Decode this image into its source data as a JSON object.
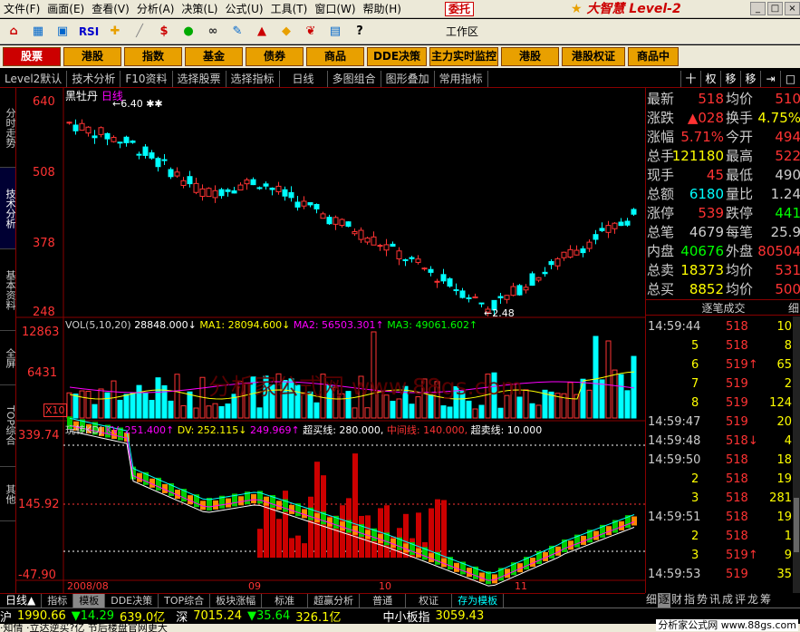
{
  "menu": [
    "文件(F)",
    "画面(E)",
    "查看(V)",
    "分析(A)",
    "决策(L)",
    "公式(U)",
    "工具(T)",
    "窗口(W)",
    "帮助(H)"
  ],
  "entrust": "委托",
  "logo": "大智慧 Level-2",
  "toolbar_icons": [
    "home-icon",
    "grid-icon",
    "window-icon",
    "rsi-icon",
    "sparkle-icon",
    "ruler-icon",
    "dollar-icon",
    "lights-icon",
    "binoculars-icon",
    "broom-icon",
    "hat-icon",
    "diamond-icon",
    "leaf-icon",
    "chart-icon",
    "help-icon"
  ],
  "toolbar": {
    "rsi": "RSI",
    "workspace": "工作区"
  },
  "nav_buttons": [
    {
      "label": "股票",
      "selected": true
    },
    {
      "label": "港股"
    },
    {
      "label": "指数"
    },
    {
      "label": "基金"
    },
    {
      "label": "债券"
    },
    {
      "label": "商品"
    },
    {
      "label": "DDE决策"
    },
    {
      "label": "主力实时监控"
    },
    {
      "label": "港股"
    },
    {
      "label": "港股权证"
    },
    {
      "label": "商品中"
    }
  ],
  "tabs": [
    "Level2默认",
    "技术分析",
    "F10资料",
    "选择股票",
    "选择指标",
    "日线",
    "多图组合",
    "图形叠加",
    "常用指标"
  ],
  "tabs_right": [
    "十",
    "权",
    "移",
    "移"
  ],
  "left_tabs": [
    {
      "label": "分时走势"
    },
    {
      "label": "技术分析",
      "selected": true
    },
    {
      "label": "基本资料"
    },
    {
      "label": "全屏"
    },
    {
      "label": "TOP综合"
    },
    {
      "label": "其他"
    }
  ],
  "chart": {
    "stock_name": "黑牡丹",
    "period": "日线",
    "price_axis": [
      "640",
      "508",
      "378",
      "248"
    ],
    "max_mark": "6.40",
    "min_mark": "2.48",
    "vol_header": {
      "label": "VOL(5,10,20)",
      "vol": "28848.000↓",
      "ma1": "MA1: 28094.600↓",
      "ma2": "MA2: 56503.301↑",
      "ma3": "MA3: 49061.602↑"
    },
    "vol_axis": [
      "12863",
      "6431",
      "X10"
    ],
    "ind_header": {
      "label": "玩转KDJ",
      "kv": "KV: 251.400↑",
      "dv": "DV: 252.115↓",
      "jv": "249.969↑",
      "buy": "超买线: 280.000,",
      "mid": "中间线: 140.000,",
      "sell": "超卖线: 10.000"
    },
    "ind_axis": [
      "339.74",
      "145.92",
      "-47.90"
    ],
    "date_labels": [
      "2008/08",
      "09",
      "10",
      "11"
    ],
    "watermark": "分析家公式网 www.88gs.com"
  },
  "chart_data": {
    "type": "candlestick",
    "stock": "黑牡丹",
    "price_range": [
      2.48,
      6.4
    ],
    "price_ticks": [
      6.4,
      5.08,
      3.78,
      2.48
    ],
    "volume_ticks": [
      12863,
      6431
    ],
    "indicator_ticks": [
      339.74,
      145.92,
      -47.9
    ],
    "indicator_lines": {
      "超买线": 280,
      "中间线": 140,
      "超卖线": 10
    }
  },
  "quote": [
    {
      "k1": "最新",
      "v1": "518",
      "k2": "均价",
      "v2": "510",
      "c1": "#f33",
      "c2": "#f33"
    },
    {
      "k1": "涨跌",
      "v1": "▲028",
      "k2": "换手",
      "v2": "4.75%",
      "c1": "#f33",
      "c2": "#ff0"
    },
    {
      "k1": "涨幅",
      "v1": "5.71%",
      "k2": "今开",
      "v2": "494",
      "c1": "#f33",
      "c2": "#f33"
    },
    {
      "k1": "总手",
      "v1": "121180",
      "k2": "最高",
      "v2": "522",
      "c1": "#ff0",
      "c2": "#f33"
    },
    {
      "k1": "现手",
      "v1": "45",
      "k2": "最低",
      "v2": "490",
      "c1": "#f33",
      "c2": "#ccc"
    },
    {
      "k1": "总额",
      "v1": "6180",
      "k2": "量比",
      "v2": "1.24",
      "c1": "#0ff",
      "c2": "#ccc"
    },
    {
      "k1": "涨停",
      "v1": "539",
      "k2": "跌停",
      "v2": "441",
      "c1": "#f33",
      "c2": "#0f0"
    },
    {
      "k1": "总笔",
      "v1": "4679",
      "k2": "每笔",
      "v2": "25.9",
      "c1": "#ccc",
      "c2": "#ccc"
    },
    {
      "k1": "内盘",
      "v1": "40676",
      "k2": "外盘",
      "v2": "80504",
      "c1": "#0f0",
      "c2": "#f33"
    },
    {
      "k1": "总卖",
      "v1": "18373",
      "k2": "均价",
      "v2": "531",
      "c1": "#ff0",
      "c2": "#f33"
    },
    {
      "k1": "总买",
      "v1": "8852",
      "k2": "均价",
      "v2": "500",
      "c1": "#ff0",
      "c2": "#f33"
    }
  ],
  "ticks_title": "逐笔成交",
  "ticks_more": "细",
  "ticks": [
    {
      "t": "14:59:44",
      "p": "518",
      "a": "10"
    },
    {
      "t": "5",
      "p": "518",
      "a": "8"
    },
    {
      "t": "6",
      "p": "519↑",
      "a": "65"
    },
    {
      "t": "7",
      "p": "519",
      "a": "2"
    },
    {
      "t": "8",
      "p": "519",
      "a": "124"
    },
    {
      "t": "14:59:47",
      "p": "519",
      "a": "20"
    },
    {
      "t": "14:59:48",
      "p": "518↓",
      "a": "4"
    },
    {
      "t": "14:59:50",
      "p": "518",
      "a": "18"
    },
    {
      "t": "2",
      "p": "518",
      "a": "19"
    },
    {
      "t": "3",
      "p": "518",
      "a": "281"
    },
    {
      "t": "14:59:51",
      "p": "518",
      "a": "19"
    },
    {
      "t": "2",
      "p": "518",
      "a": "1"
    },
    {
      "t": "3",
      "p": "519↑",
      "a": "9"
    },
    {
      "t": "14:59:53",
      "p": "519",
      "a": "35"
    }
  ],
  "bottom_tabs": [
    {
      "label": "日线▲"
    },
    {
      "label": "指标"
    },
    {
      "label": "模板",
      "selected": true
    },
    {
      "label": "DDE决策"
    },
    {
      "label": "TOP综合"
    },
    {
      "label": "板块涨幅"
    },
    {
      "label": "标准"
    },
    {
      "label": "超赢分析"
    },
    {
      "label": "普通"
    },
    {
      "label": "权证"
    },
    {
      "label": "存为模板",
      "cyan": true
    }
  ],
  "right_bottom_tabs": [
    "细",
    "逐",
    "财",
    "指",
    "势",
    "讯",
    "成",
    "评",
    "龙",
    "筹"
  ],
  "status": [
    {
      "label": "沪",
      "color": "#fff"
    },
    {
      "label": "1990.66",
      "color": "#ff0"
    },
    {
      "label": "▼14.29",
      "color": "#0f0"
    },
    {
      "label": "639.0亿",
      "color": "#ff0"
    },
    {
      "label": "深",
      "color": "#fff"
    },
    {
      "label": "7015.24",
      "color": "#ff0"
    },
    {
      "label": "▼35.64",
      "color": "#0f0"
    },
    {
      "label": "326.1亿",
      "color": "#ff0"
    },
    {
      "label": "中小板指",
      "color": "#fff"
    },
    {
      "label": "3059.43",
      "color": "#ff0"
    }
  ],
  "news": "·知情  ·立达逆买?亿  节后楼盘官网更大",
  "site": "分析家公式网 www.88gs.com"
}
